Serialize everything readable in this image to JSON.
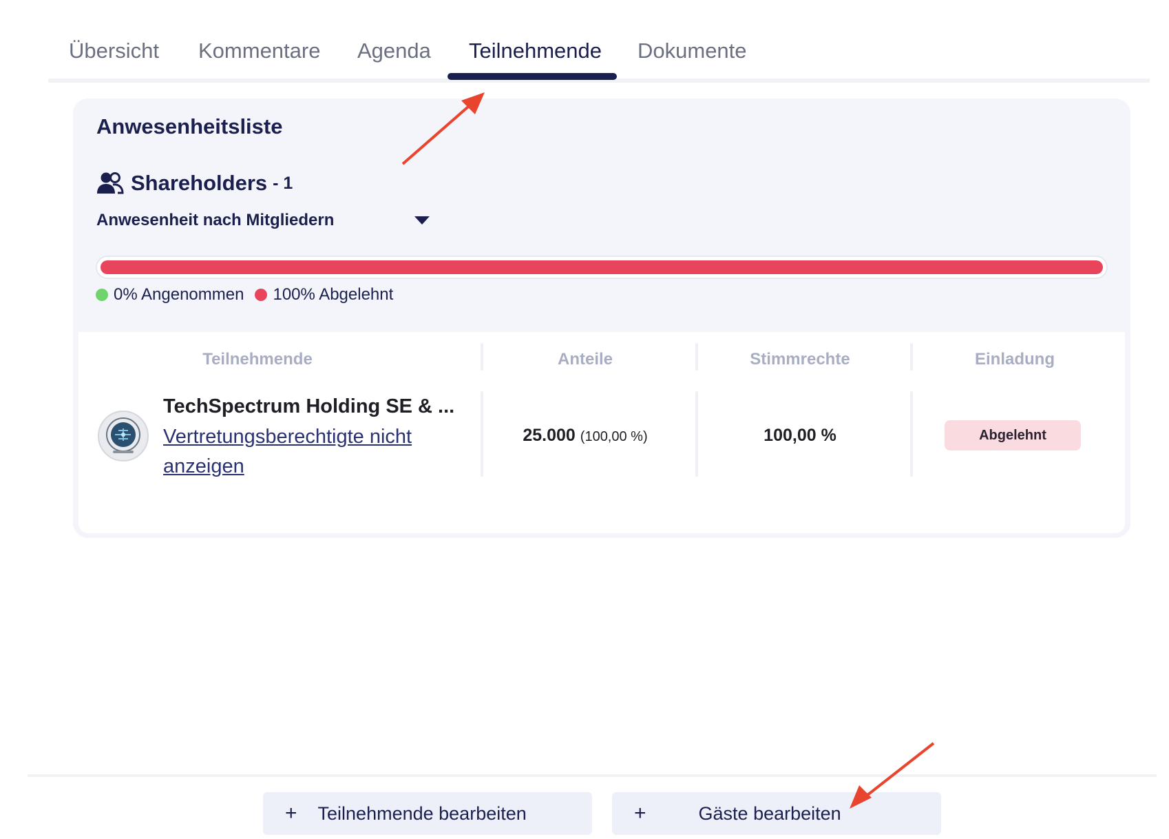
{
  "tabs": [
    {
      "label": "Übersicht"
    },
    {
      "label": "Kommentare"
    },
    {
      "label": "Agenda"
    },
    {
      "label": "Teilnehmende",
      "active": true
    },
    {
      "label": "Dokumente"
    }
  ],
  "card": {
    "title": "Anwesenheitsliste",
    "group": {
      "name": "Shareholders",
      "count": "- 1",
      "icon": "users-icon"
    },
    "filter": {
      "label": "Anwesenheit nach Mitgliedern"
    },
    "progress": {
      "accepted_fraction": 0.0,
      "declined_fraction": 1.0
    },
    "legend": {
      "accepted": {
        "label": "0% Angenommen",
        "color": "#6fd46b"
      },
      "declined": {
        "label": "100% Abgelehnt",
        "color": "#e8455c"
      }
    }
  },
  "table": {
    "headers": [
      "Teilnehmende",
      "Anteile",
      "Stimmrechte",
      "Einladung"
    ],
    "rows": [
      {
        "name": "TechSpectrum Holding SE & ...",
        "link": "Vertretungsberechtigte nicht anzeigen",
        "shares": "25.000",
        "shares_pct": "(100,00 %)",
        "votes": "100,00 %",
        "invitation": "Abgelehnt"
      }
    ]
  },
  "footer": {
    "edit_participants": "Teilnehmende bearbeiten",
    "edit_guests": "Gäste bearbeiten",
    "plus": "+"
  },
  "colors": {
    "primary": "#1a1f4e",
    "declined": "#e8455c",
    "accepted": "#6fd46b",
    "annotation_arrow": "#e8442e"
  }
}
